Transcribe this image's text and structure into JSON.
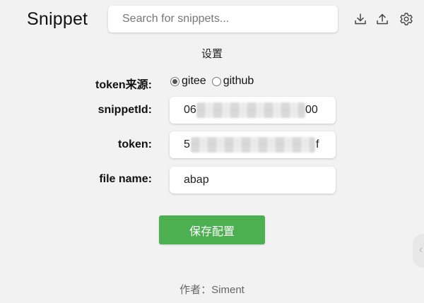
{
  "header": {
    "app_title": "Snippet",
    "search": {
      "placeholder": "Search for snippets...",
      "value": ""
    },
    "icons": [
      "download-icon",
      "upload-icon",
      "gear-icon"
    ]
  },
  "settings": {
    "title": "设置",
    "token_source": {
      "label": "token来源:",
      "options": [
        {
          "label": "gitee",
          "checked": true
        },
        {
          "label": "github",
          "checked": false
        }
      ]
    },
    "snippet_id": {
      "label": "snippetId:",
      "value_start": "06",
      "value_end": "00"
    },
    "token": {
      "label": "token:",
      "value_start": "5",
      "value_end": "f"
    },
    "file_name": {
      "label": "file name:",
      "value": "abap"
    },
    "save_label": "保存配置"
  },
  "footer": {
    "author": "作者：Siment"
  },
  "colors": {
    "accent": "#4caf50",
    "background": "#f2f2f2"
  }
}
